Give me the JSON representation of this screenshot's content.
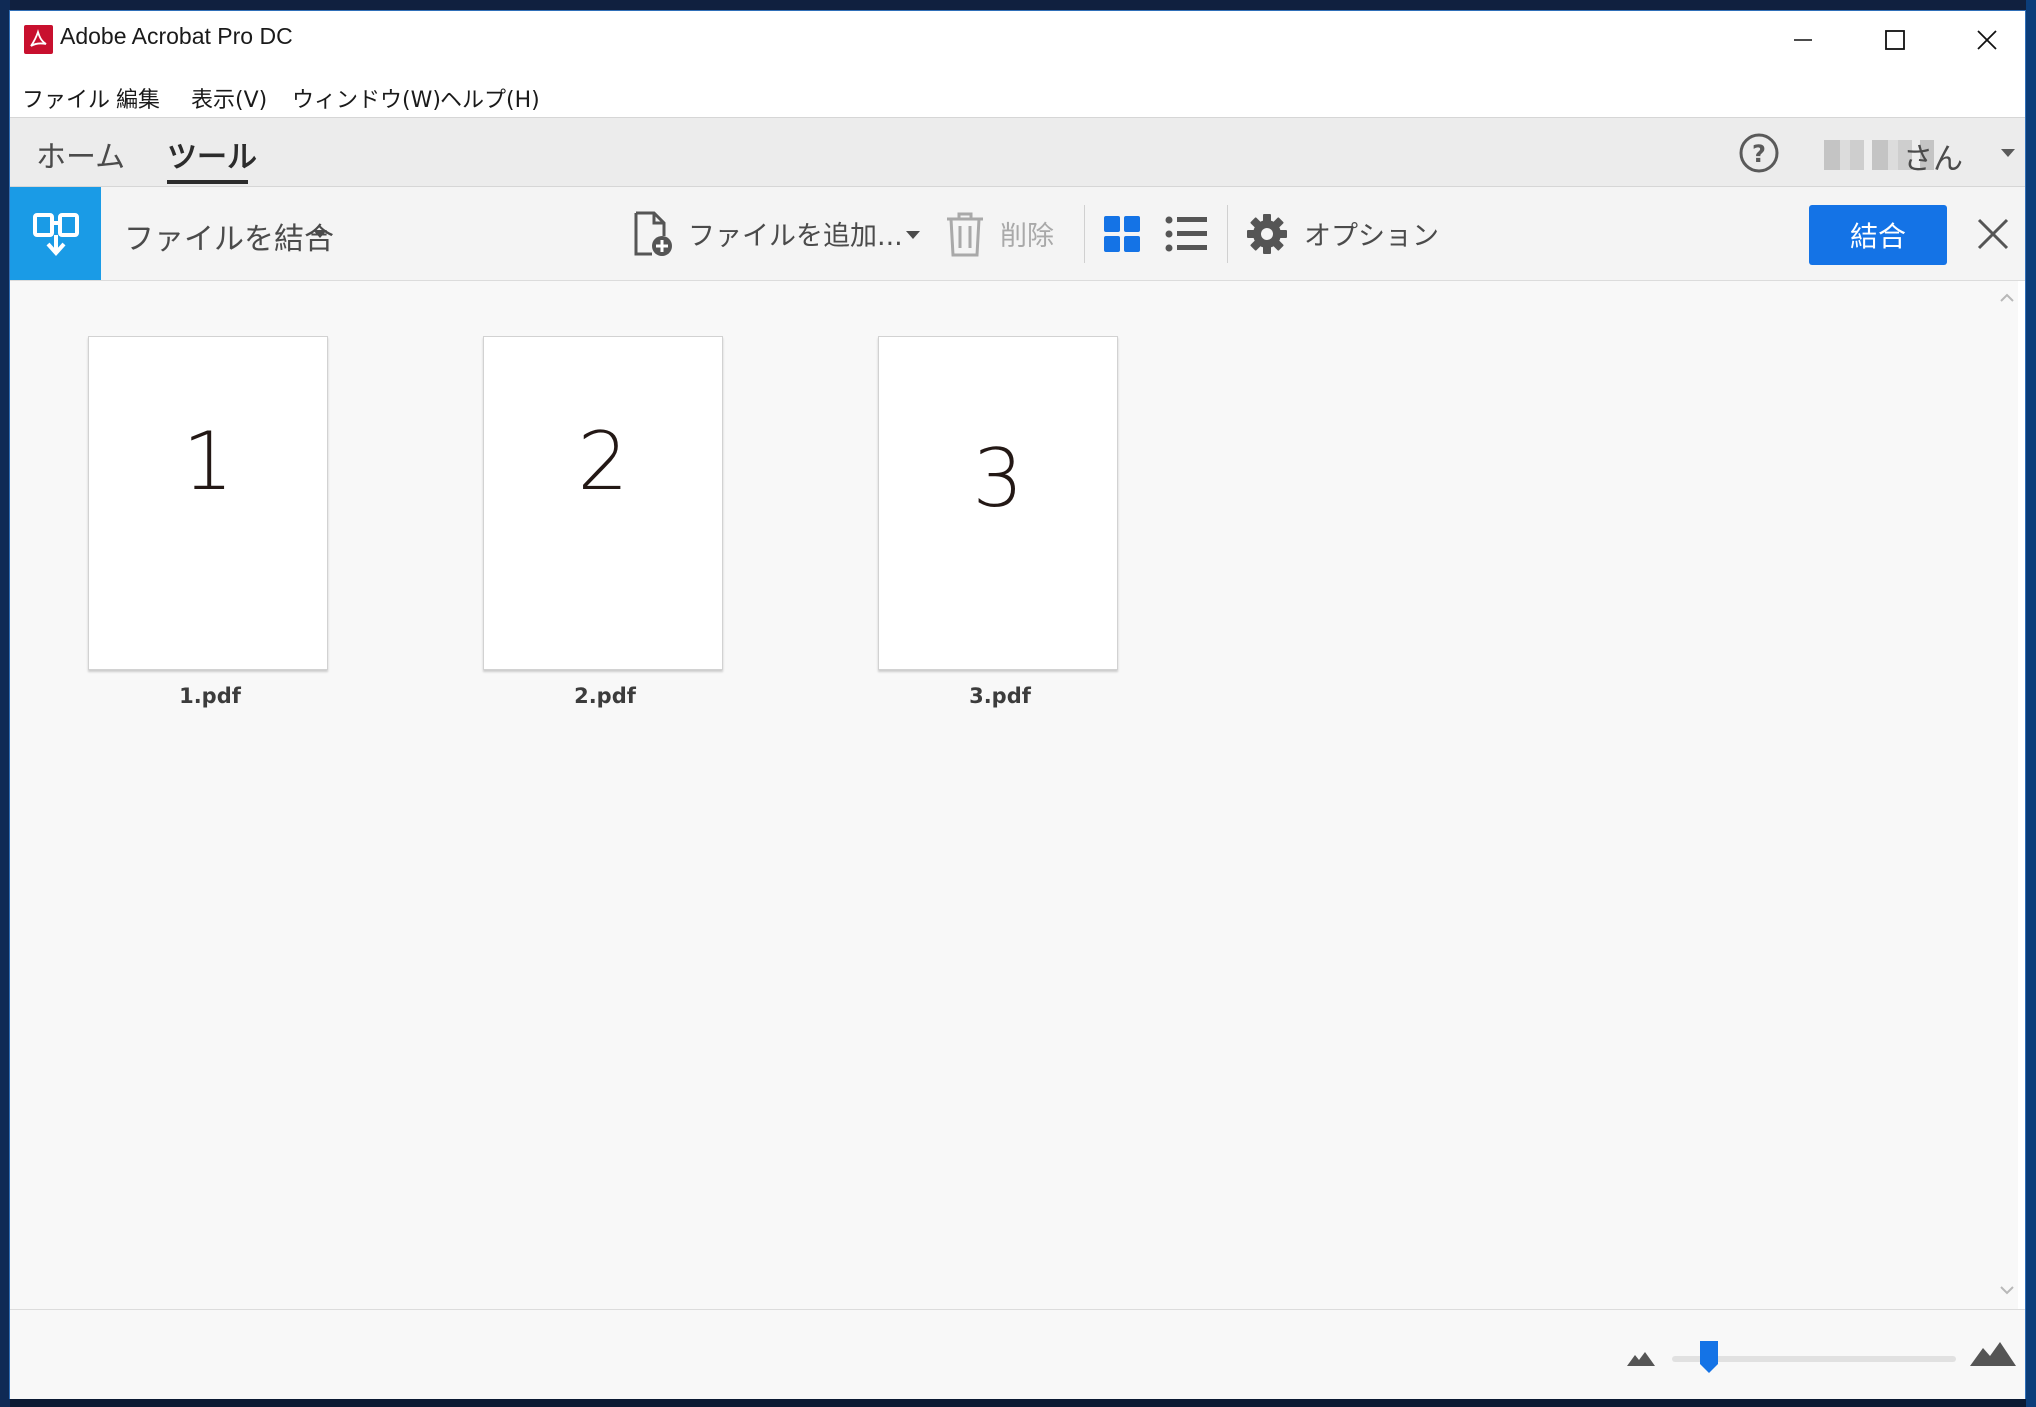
{
  "window": {
    "title": "Adobe Acrobat Pro DC"
  },
  "menu": {
    "items": [
      "ファイル",
      "編集",
      "表示(V)",
      "ウィンドウ(W)",
      "ヘルプ(H)"
    ]
  },
  "nav": {
    "tabs": [
      {
        "label": "ホーム",
        "active": false
      },
      {
        "label": "ツール",
        "active": true
      }
    ],
    "user_suffix": "さん"
  },
  "toolbar": {
    "tool_name": "ファイルを結合",
    "add_files_label": "ファイルを追加...",
    "delete_label": "削除",
    "options_label": "オプション",
    "combine_label": "結合"
  },
  "files": [
    {
      "name": "1.pdf",
      "page_text": "1"
    },
    {
      "name": "2.pdf",
      "page_text": "2"
    },
    {
      "name": "3.pdf",
      "page_text": "3"
    }
  ],
  "zoom": {
    "level_fraction": 0.13
  },
  "colors": {
    "accent": "#1473e6",
    "tool_badge": "#1a9be6",
    "app_icon": "#c8102e"
  },
  "icons": {
    "app": "acrobat-icon",
    "help": "help-icon",
    "tool": "combine-files-icon",
    "add_file": "add-file-icon",
    "delete": "trash-icon",
    "grid_view": "grid-view-icon",
    "list_view": "list-view-icon",
    "options": "gear-icon",
    "close": "close-icon"
  }
}
